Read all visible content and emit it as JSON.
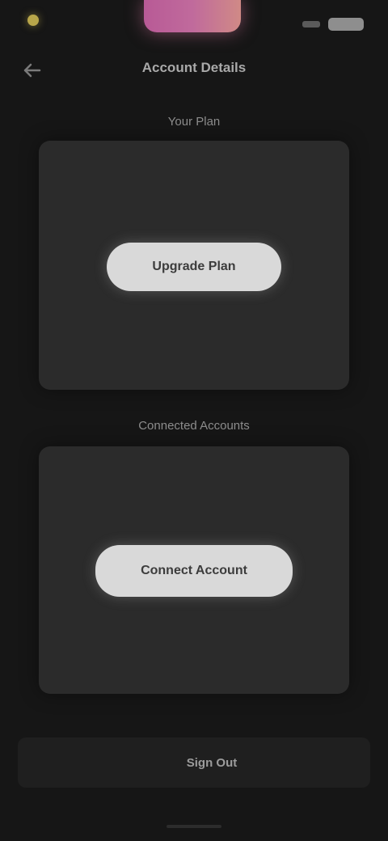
{
  "status_bar": {
    "time": "",
    "accent": "#c06a9c"
  },
  "app_bar": {
    "back_icon": "arrow-left-icon",
    "title": "Account Details"
  },
  "sections": [
    {
      "label": "Your Plan",
      "button_label": "Upgrade Plan"
    },
    {
      "label": "Connected Accounts",
      "button_label": "Connect Account"
    }
  ],
  "bottom_bar": {
    "button_label": "Sign Out"
  },
  "colors": {
    "background": "#161616",
    "card": "#2b2b2b",
    "button": "#d9d9d9",
    "notch_gradient_start": "#b85a96",
    "notch_gradient_end": "#d08a86"
  }
}
